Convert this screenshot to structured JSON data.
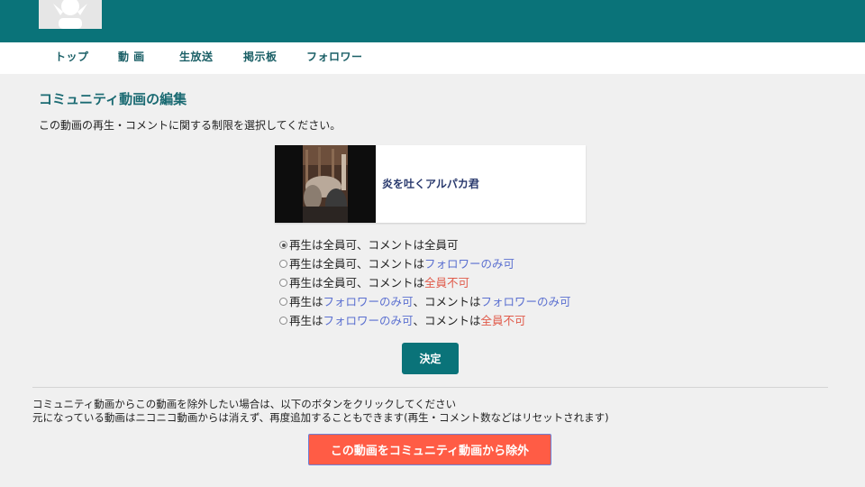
{
  "colors": {
    "header_bg": "#0a7379",
    "nav_text": "#1a5f66",
    "link_blue": "#5a6fd0",
    "warning_red": "#e05a4a",
    "remove_button_bg": "#ff5c45"
  },
  "header": {
    "avatar_icon": "user-avatar-icon"
  },
  "nav": {
    "items": [
      {
        "label": "トップ"
      },
      {
        "label": "動 画"
      },
      {
        "label": "生放送"
      },
      {
        "label": "掲示板"
      },
      {
        "label": "フォロワー"
      }
    ]
  },
  "page": {
    "title": "コミュニティ動画の編集",
    "instruction": "この動画の再生・コメントに関する制限を選択してください。"
  },
  "video": {
    "title": "炎を吐くアルパカ君"
  },
  "options": [
    {
      "checked": true,
      "parts": [
        "再生は",
        "全員可",
        "、コメントは",
        "全員可"
      ]
    },
    {
      "checked": false,
      "parts": [
        "再生は",
        "全員可",
        "、コメントは",
        "フォロワーのみ可"
      ]
    },
    {
      "checked": false,
      "parts": [
        "再生は",
        "全員可",
        "、コメントは",
        "全員不可"
      ]
    },
    {
      "checked": false,
      "parts": [
        "再生は",
        "フォロワーのみ可",
        "、コメントは",
        "フォロワーのみ可"
      ]
    },
    {
      "checked": false,
      "parts": [
        "再生は",
        "フォロワーのみ可",
        "、コメントは",
        "全員不可"
      ]
    }
  ],
  "decide_button": {
    "label": "決定"
  },
  "remove_section": {
    "line1": "コミュニティ動画からこの動画を除外したい場合は、以下のボタンをクリックしてください",
    "line2": "元になっている動画はニコニコ動画からは消えず、再度追加することもできます(再生・コメント数などはリセットされます)",
    "button_label": "この動画をコミュニティ動画から除外"
  }
}
